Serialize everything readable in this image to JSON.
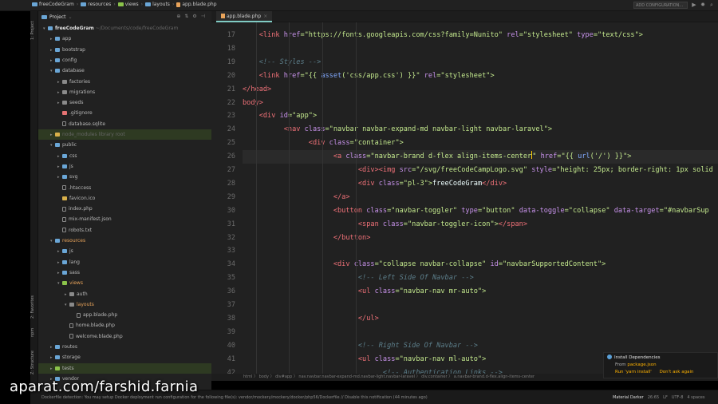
{
  "breadcrumbs": [
    "freeCodeGram",
    "resources",
    "views",
    "layouts",
    "app.blade.php"
  ],
  "run_config_label": "ADD CONFIGURATION...",
  "tool_tabs": [
    "1: Project",
    "2: Favorites",
    "npm",
    "Z: Structure"
  ],
  "project_panel": {
    "title": "Project",
    "tree": [
      {
        "label": "freeCodeGram",
        "suffix": " ~/Documents/code/freeCodeGram",
        "indent": 0,
        "arrow": "▾",
        "color": "f-blue",
        "bold": true
      },
      {
        "label": "app",
        "indent": 1,
        "arrow": "▸",
        "color": "f-blue"
      },
      {
        "label": "bootstrap",
        "indent": 1,
        "arrow": "▸",
        "color": "f-blue"
      },
      {
        "label": "config",
        "indent": 1,
        "arrow": "▸",
        "color": "f-blue"
      },
      {
        "label": "database",
        "indent": 1,
        "arrow": "▾",
        "color": "f-blue"
      },
      {
        "label": "factories",
        "indent": 2,
        "arrow": "▸",
        "color": "f-grey"
      },
      {
        "label": "migrations",
        "indent": 2,
        "arrow": "▸",
        "color": "f-grey"
      },
      {
        "label": "seeds",
        "indent": 2,
        "arrow": "▸",
        "color": "f-grey"
      },
      {
        "label": ".gitignore",
        "indent": 2,
        "arrow": "",
        "color": "f-red"
      },
      {
        "label": "database.sqlite",
        "indent": 2,
        "arrow": "",
        "color": "file"
      },
      {
        "label": "node_modules",
        "suffix": " library root",
        "indent": 1,
        "arrow": "▸",
        "color": "f-yellow",
        "dim": true,
        "hl": "hl-green"
      },
      {
        "label": "public",
        "indent": 1,
        "arrow": "▾",
        "color": "f-blue"
      },
      {
        "label": "css",
        "indent": 2,
        "arrow": "▸",
        "color": "f-blue"
      },
      {
        "label": "js",
        "indent": 2,
        "arrow": "▸",
        "color": "f-blue"
      },
      {
        "label": "svg",
        "indent": 2,
        "arrow": "▸",
        "color": "f-blue"
      },
      {
        "label": ".htaccess",
        "indent": 2,
        "arrow": "",
        "color": "file"
      },
      {
        "label": "favicon.ico",
        "indent": 2,
        "arrow": "",
        "color": "f-yellow"
      },
      {
        "label": "index.php",
        "indent": 2,
        "arrow": "",
        "color": "file"
      },
      {
        "label": "mix-manifest.json",
        "indent": 2,
        "arrow": "",
        "color": "file"
      },
      {
        "label": "robots.txt",
        "indent": 2,
        "arrow": "",
        "color": "file"
      },
      {
        "label": "resources",
        "indent": 1,
        "arrow": "▾",
        "color": "f-blue",
        "orange": true
      },
      {
        "label": "js",
        "indent": 2,
        "arrow": "▸",
        "color": "f-blue"
      },
      {
        "label": "lang",
        "indent": 2,
        "arrow": "▸",
        "color": "f-blue"
      },
      {
        "label": "sass",
        "indent": 2,
        "arrow": "▸",
        "color": "f-blue"
      },
      {
        "label": "views",
        "indent": 2,
        "arrow": "▾",
        "color": "f-green",
        "orange": true
      },
      {
        "label": "auth",
        "indent": 3,
        "arrow": "▸",
        "color": "f-grey"
      },
      {
        "label": "layouts",
        "indent": 3,
        "arrow": "▾",
        "color": "f-grey",
        "orange": true
      },
      {
        "label": "app.blade.php",
        "indent": 4,
        "arrow": "",
        "color": "file"
      },
      {
        "label": "home.blade.php",
        "indent": 3,
        "arrow": "",
        "color": "file"
      },
      {
        "label": "welcome.blade.php",
        "indent": 3,
        "arrow": "",
        "color": "file"
      },
      {
        "label": "routes",
        "indent": 1,
        "arrow": "▸",
        "color": "f-blue"
      },
      {
        "label": "storage",
        "indent": 1,
        "arrow": "▸",
        "color": "f-blue"
      },
      {
        "label": "tests",
        "indent": 1,
        "arrow": "▸",
        "color": "f-green",
        "hl": "hl-green"
      },
      {
        "label": "vendor",
        "indent": 1,
        "arrow": "▸",
        "color": "f-blue"
      }
    ]
  },
  "editor": {
    "tab_label": "app.blade.php",
    "current_line": 26,
    "lines": [
      {
        "n": 17,
        "indent": 2,
        "segs": [
          [
            "<link ",
            "tag"
          ],
          [
            "href",
            "attr"
          ],
          [
            "=\"https://fonts.googleapis.com/css?family=Nunito\" ",
            "str"
          ],
          [
            "rel",
            "attr"
          ],
          [
            "=\"stylesheet\" ",
            "str"
          ],
          [
            "type",
            "attr"
          ],
          [
            "=\"text/css\">",
            "str"
          ]
        ]
      },
      {
        "n": 18,
        "indent": 0,
        "segs": []
      },
      {
        "n": 19,
        "indent": 2,
        "segs": [
          [
            "<!-- Styles -->",
            "com"
          ]
        ]
      },
      {
        "n": 20,
        "indent": 2,
        "segs": [
          [
            "<link ",
            "tag"
          ],
          [
            "href",
            "attr"
          ],
          [
            "=\"{{ ",
            "str"
          ],
          [
            "asset",
            "fn"
          ],
          [
            "('css/app.css') }}\" ",
            "str"
          ],
          [
            "rel",
            "attr"
          ],
          [
            "=\"stylesheet\">",
            "str"
          ]
        ]
      },
      {
        "n": 21,
        "indent": 0,
        "segs": [
          [
            "</head>",
            "tag"
          ]
        ]
      },
      {
        "n": 22,
        "indent": 0,
        "segs": [
          [
            "body>",
            "tag"
          ]
        ]
      },
      {
        "n": 23,
        "indent": 2,
        "segs": [
          [
            "<div ",
            "tag"
          ],
          [
            "id",
            "attr"
          ],
          [
            "=\"app\">",
            "str"
          ]
        ]
      },
      {
        "n": 24,
        "indent": 5,
        "segs": [
          [
            "<nav ",
            "tag"
          ],
          [
            "class",
            "attr"
          ],
          [
            "=\"navbar navbar-expand-md navbar-light navbar-laravel\">",
            "str"
          ]
        ]
      },
      {
        "n": 25,
        "indent": 8,
        "segs": [
          [
            "<div ",
            "tag"
          ],
          [
            "class",
            "attr"
          ],
          [
            "=\"container\">",
            "str"
          ]
        ]
      },
      {
        "n": 26,
        "indent": 11,
        "segs": [
          [
            "<a ",
            "tag"
          ],
          [
            "class",
            "attr"
          ],
          [
            "=\"navbar-brand d-flex align-items-center",
            "str"
          ],
          [
            "|",
            "caret"
          ],
          [
            "\" ",
            "str"
          ],
          [
            "href",
            "attr"
          ],
          [
            "=\"{{ ",
            "str"
          ],
          [
            "url",
            "fn"
          ],
          [
            "('/') }}\">",
            "str"
          ]
        ]
      },
      {
        "n": 27,
        "indent": 14,
        "segs": [
          [
            "<div><img ",
            "tag"
          ],
          [
            "src",
            "attr"
          ],
          [
            "=\"/svg/freeCodeCampLogo.svg\" ",
            "str"
          ],
          [
            "style",
            "attr"
          ],
          [
            "=\"height: 25px; border-right: 1px solid",
            "str"
          ]
        ]
      },
      {
        "n": 28,
        "indent": 14,
        "segs": [
          [
            "<div ",
            "tag"
          ],
          [
            "class",
            "attr"
          ],
          [
            "=\"pl-3\">",
            "str"
          ],
          [
            "freeCodeGram",
            "text"
          ],
          [
            "</div>",
            "tag"
          ]
        ]
      },
      {
        "n": 29,
        "indent": 11,
        "segs": [
          [
            "</a>",
            "tag"
          ]
        ]
      },
      {
        "n": 30,
        "indent": 11,
        "segs": [
          [
            "<button ",
            "tag"
          ],
          [
            "class",
            "attr"
          ],
          [
            "=\"navbar-toggler\" ",
            "str"
          ],
          [
            "type",
            "attr"
          ],
          [
            "=\"button\" ",
            "str"
          ],
          [
            "data-toggle",
            "attr"
          ],
          [
            "=\"collapse\" ",
            "str"
          ],
          [
            "data-target",
            "attr"
          ],
          [
            "=\"#navbarSup",
            "str"
          ]
        ]
      },
      {
        "n": 31,
        "indent": 14,
        "segs": [
          [
            "<span ",
            "tag"
          ],
          [
            "class",
            "attr"
          ],
          [
            "=\"navbar-toggler-icon\">",
            "str"
          ],
          [
            "</span>",
            "tag"
          ]
        ]
      },
      {
        "n": 32,
        "indent": 11,
        "segs": [
          [
            "</button>",
            "tag"
          ]
        ]
      },
      {
        "n": 33,
        "indent": 0,
        "segs": []
      },
      {
        "n": 34,
        "indent": 11,
        "segs": [
          [
            "<div ",
            "tag"
          ],
          [
            "class",
            "attr"
          ],
          [
            "=\"collapse navbar-collapse\" ",
            "str"
          ],
          [
            "id",
            "attr"
          ],
          [
            "=\"navbarSupportedContent\">",
            "str"
          ]
        ]
      },
      {
        "n": 35,
        "indent": 14,
        "segs": [
          [
            "<!-- Left Side Of Navbar -->",
            "com"
          ]
        ]
      },
      {
        "n": 36,
        "indent": 14,
        "segs": [
          [
            "<ul ",
            "tag"
          ],
          [
            "class",
            "attr"
          ],
          [
            "=\"navbar-nav mr-auto\">",
            "str"
          ]
        ]
      },
      {
        "n": 37,
        "indent": 0,
        "segs": []
      },
      {
        "n": 38,
        "indent": 14,
        "segs": [
          [
            "</ul>",
            "tag"
          ]
        ]
      },
      {
        "n": 39,
        "indent": 0,
        "segs": []
      },
      {
        "n": 40,
        "indent": 14,
        "segs": [
          [
            "<!-- Right Side Of Navbar -->",
            "com"
          ]
        ]
      },
      {
        "n": 41,
        "indent": 14,
        "segs": [
          [
            "<ul ",
            "tag"
          ],
          [
            "class",
            "attr"
          ],
          [
            "=\"navbar-nav ml-auto\">",
            "str"
          ]
        ]
      },
      {
        "n": 42,
        "indent": 17,
        "segs": [
          [
            "<!-- Authentication Links -->",
            "com"
          ]
        ]
      }
    ]
  },
  "editor_breadcrumb": "html  〉 body  〉 div#app  〉 nav.navbar.navbar-expand-md.navbar-light.navbar-laravel  〉 div.container  〉 a.navbar-brand.d-flex.align-items-center",
  "notification": {
    "title": "Install Dependencies",
    "body_prefix": "From ",
    "body_link": "package.json",
    "actions": [
      "Run 'yarn install'",
      "Don't ask again"
    ]
  },
  "status_bar": {
    "message": "Dockerfile detection: You may setup Docker deployment run configuration for the following file(s): vendor/mockery/mockery/docker/php56/Dockerfile // Disable this notification (44 minutes ago)",
    "theme": "Material Darker",
    "position": "26:65",
    "line_sep": "LF",
    "encoding": "UTF-8",
    "indent": "4 spaces"
  },
  "watermark": "aparat.com/farshid.farnia",
  "colors": {
    "tag": "#f07178",
    "attr": "#c792ea",
    "str": "#c3e88d",
    "fn": "#82aaff",
    "text": "#eeffff",
    "com": "#5c7e8a"
  }
}
